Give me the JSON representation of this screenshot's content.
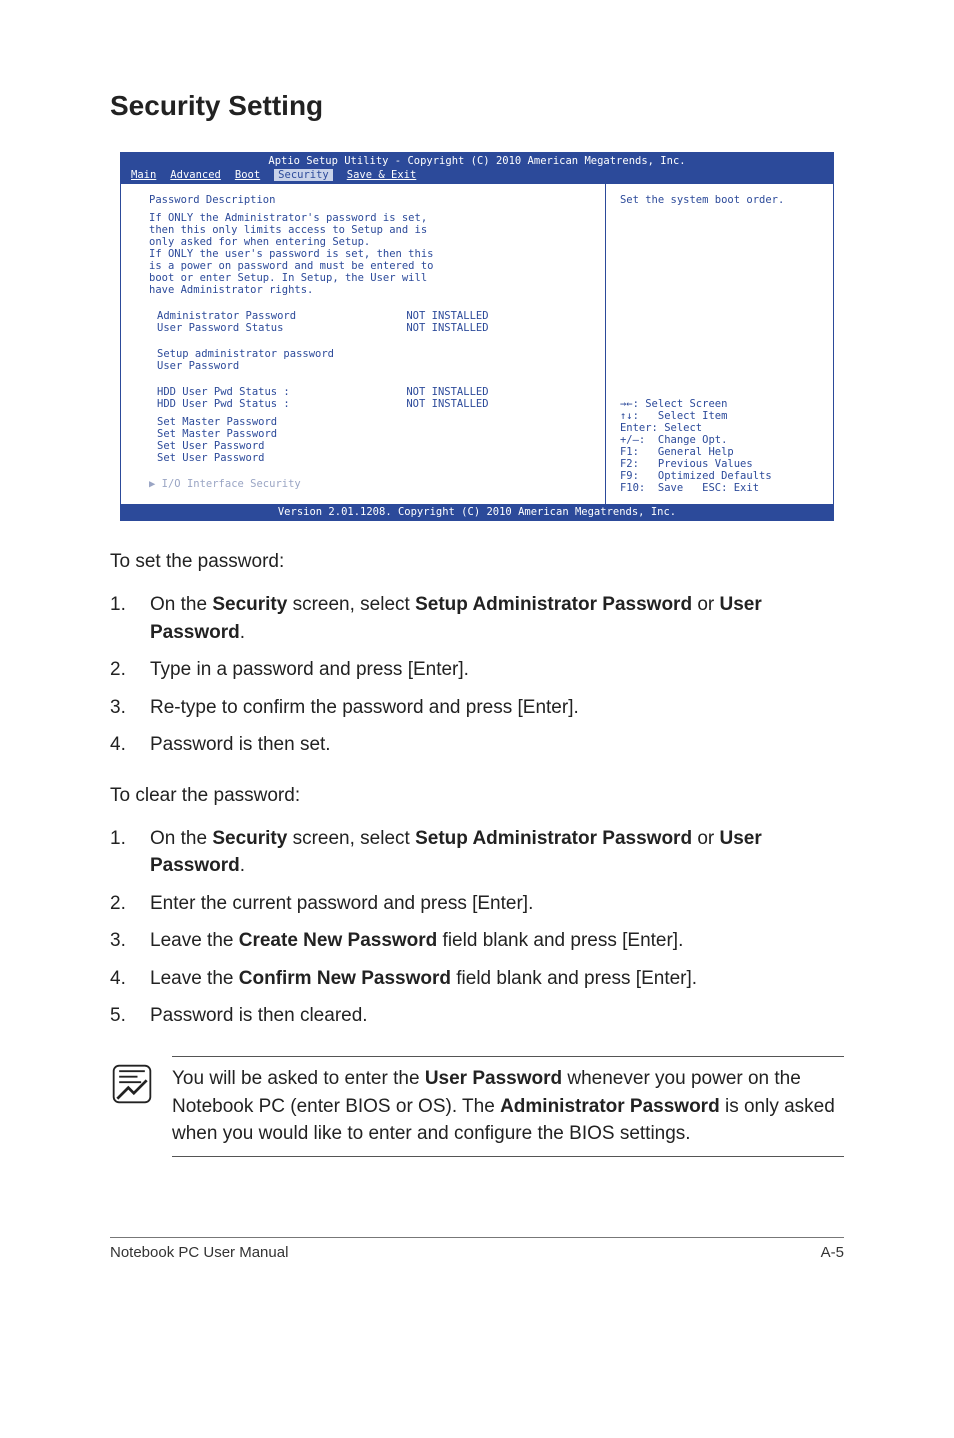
{
  "heading": "Security Setting",
  "bios": {
    "titlebar": "Aptio Setup Utility - Copyright (C) 2010 American Megatrends, Inc.",
    "tabs": {
      "main": "Main",
      "advanced": "Advanced",
      "boot": "Boot",
      "security": "Security",
      "save": "Save & Exit"
    },
    "pw_desc_title": "Password Description",
    "pw_desc_lines": {
      "l1": "If ONLY the Administrator's password is set,",
      "l2": "then this only limits access to Setup and is",
      "l3": "only asked for when entering Setup.",
      "l4": "If ONLY the user's password is set, then this",
      "l5": "is a power on password and must be entered to",
      "l6": "boot or enter Setup. In Setup, the User will",
      "l7": "have Administrator rights."
    },
    "rows": {
      "admin_pw_label": "Administrator Password",
      "admin_pw_val": "NOT INSTALLED",
      "user_pw_status_label": "User Password Status",
      "user_pw_status_val": "NOT INSTALLED",
      "setup_admin_pw": "Setup administrator password",
      "user_pw": "User Password",
      "hdd_user_pwd1_label": "HDD User Pwd Status :",
      "hdd_user_pwd1_val": "NOT INSTALLED",
      "hdd_user_pwd2_label": "HDD User Pwd Status :",
      "hdd_user_pwd2_val": "NOT INSTALLED",
      "set_master_pw1": "Set Master Password",
      "set_master_pw2": "Set Master Password",
      "set_user_pw1": "Set User Password",
      "set_user_pw2": "Set User Password",
      "io_interface": "I/O Interface Security"
    },
    "right_help": "Set the system boot order.",
    "navhelp": {
      "l1": "→←: Select Screen",
      "l2": "↑↓:   Select Item",
      "l3": "Enter: Select",
      "l4": "+/—:  Change Opt.",
      "l5": "F1:   General Help",
      "l6": "F2:   Previous Values",
      "l7": "F9:   Optimized Defaults",
      "l8": "F10:  Save   ESC: Exit"
    },
    "footer": "Version 2.01.1208. Copyright (C) 2010 American Megatrends, Inc."
  },
  "set_pw_intro": "To set the password:",
  "set_pw_steps": {
    "s1a": "On the ",
    "s1b": "Security",
    "s1c": " screen, select ",
    "s1d": "Setup Administrator Password",
    "s1e": " or ",
    "s1f": "User Password",
    "s1g": ".",
    "s2": "Type in a password and press [Enter].",
    "s3": "Re-type to confirm the password and press [Enter].",
    "s4": "Password is then set."
  },
  "clear_pw_intro": "To clear the password:",
  "clear_pw_steps": {
    "s1a": "On the ",
    "s1b": "Security",
    "s1c": " screen, select ",
    "s1d": "Setup Administrator Password",
    "s1e": " or ",
    "s1f": "User Password",
    "s1g": ".",
    "s2": "Enter the current password and press [Enter].",
    "s3a": "Leave the ",
    "s3b": "Create New Password",
    "s3c": " field blank and press [Enter].",
    "s4a": "Leave the ",
    "s4b": "Confirm New Password",
    "s4c": " field blank and press [Enter].",
    "s5": "Password is then cleared."
  },
  "note": {
    "t1": "You will be asked to enter the ",
    "t2": "User Password",
    "t3": " whenever you power on the Notebook PC (enter BIOS or OS). The ",
    "t4": "Administrator Password",
    "t5": " is only asked when you would like to enter and configure the BIOS settings."
  },
  "footer": {
    "left": "Notebook PC User Manual",
    "right": "A-5"
  },
  "nums": {
    "n1": "1.",
    "n2": "2.",
    "n3": "3.",
    "n4": "4.",
    "n5": "5."
  }
}
